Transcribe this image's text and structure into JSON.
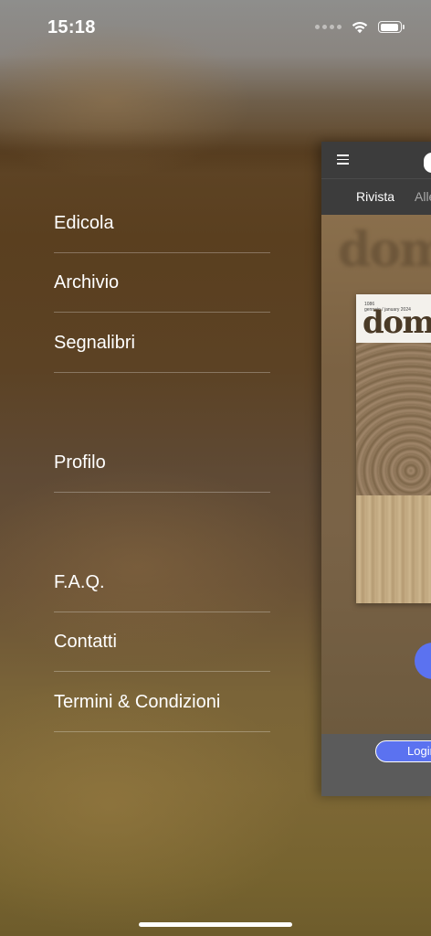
{
  "status_bar": {
    "time": "15:18",
    "icons": [
      "signal-icon",
      "wifi-icon",
      "battery-icon"
    ]
  },
  "menu": {
    "items": [
      {
        "label": "Edicola"
      },
      {
        "label": "Archivio"
      },
      {
        "label": "Segnalibri"
      },
      {
        "label": "Profilo"
      },
      {
        "label": "F.A.Q."
      },
      {
        "label": "Contatti"
      },
      {
        "label": "Termini & Condizioni"
      }
    ]
  },
  "preview": {
    "tabs": [
      {
        "label": "Rivista"
      },
      {
        "label": "Alle"
      }
    ],
    "cover": {
      "issue_number": "1086",
      "issue_date": "gennaio / january 2024",
      "title": "domus"
    },
    "login_label": "Login"
  },
  "colors": {
    "accent": "#5b72f0",
    "header": "#3c3c3c",
    "footer": "#5b5b5b"
  }
}
